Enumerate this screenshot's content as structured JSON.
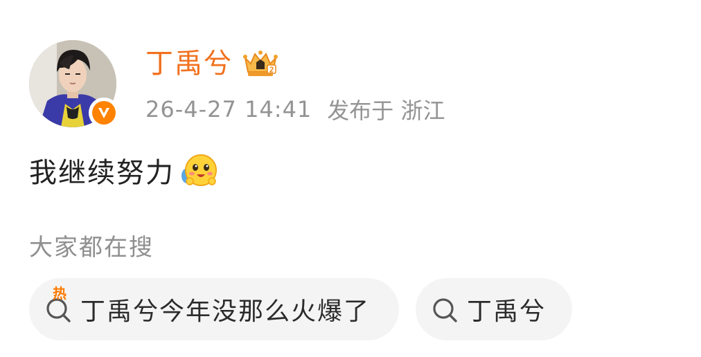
{
  "post": {
    "username": "丁禹兮",
    "timestamp": "26-4-27 14:41",
    "location": "发布于 浙江",
    "content": "我继续努力",
    "emoji": "emoji-smile-icon"
  },
  "search": {
    "title": "大家都在搜",
    "chips": [
      {
        "label": "丁禹兮今年没那么火爆了",
        "hot_label": "热"
      },
      {
        "label": "丁禹兮"
      }
    ]
  },
  "colors": {
    "username": "#f2701d",
    "meta": "#939393",
    "badge": "#ff8200",
    "hot": "#ff7a00",
    "chip_bg": "#f4f4f4"
  }
}
